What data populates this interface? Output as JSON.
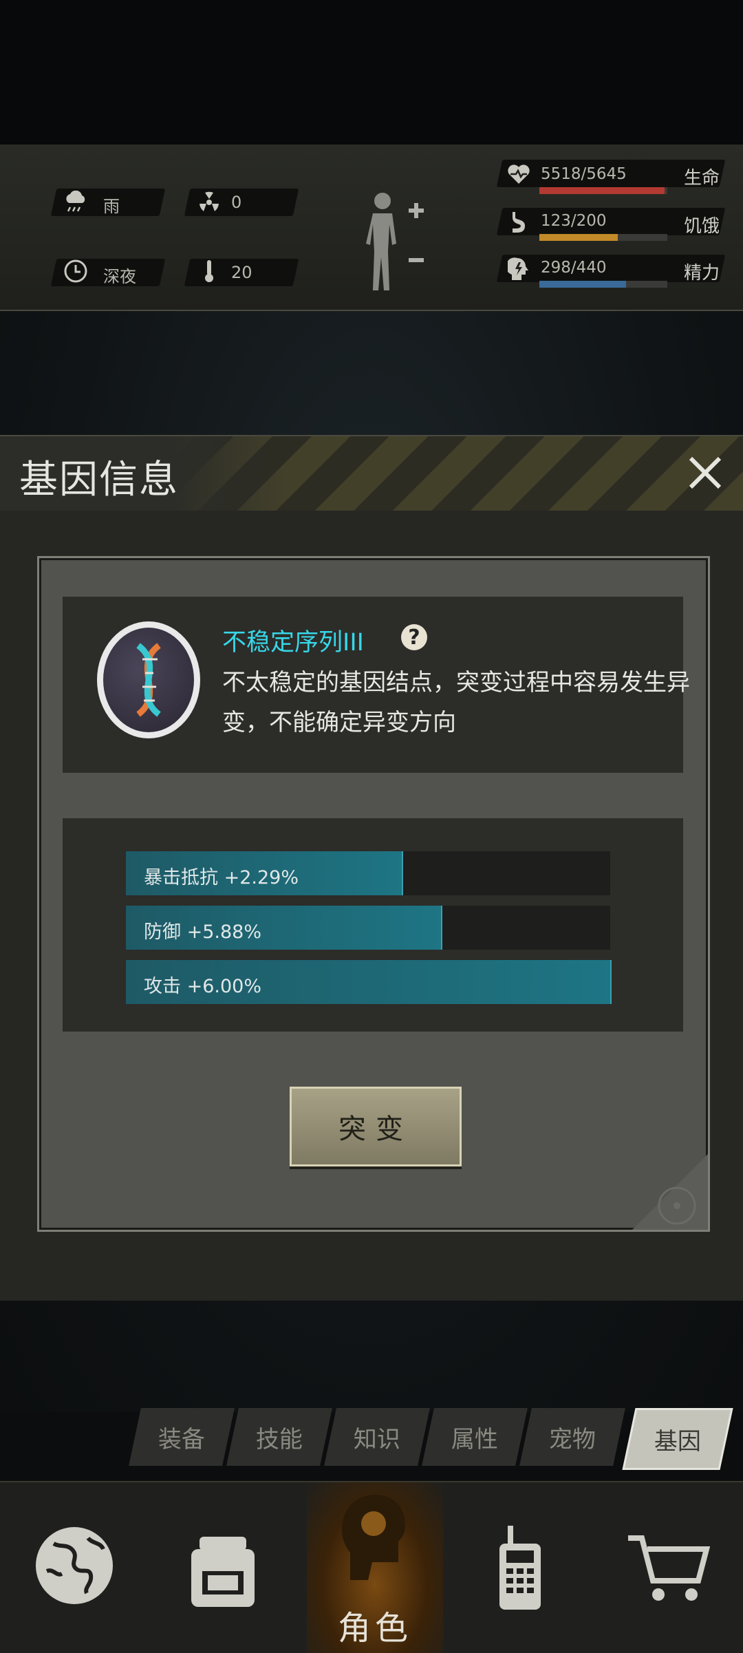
{
  "status": {
    "weather": "雨",
    "radiation": "0",
    "time_of_day": "深夜",
    "temperature": "20",
    "hp": {
      "text": "5518/5645",
      "label": "生命",
      "fraction": 0.977,
      "color": "#b23a32"
    },
    "hunger": {
      "text": "123/200",
      "label": "饥饿",
      "fraction": 0.615,
      "color": "#c28a28"
    },
    "energy": {
      "text": "298/440",
      "label": "精力",
      "fraction": 0.677,
      "color": "#3a6a9a"
    }
  },
  "modal": {
    "title": "基因信息",
    "gene_name": "不稳定序列III",
    "help": "?",
    "description": "不太稳定的基因结点，突变过程中容易发生异变，不能确定异变方向",
    "stats": [
      {
        "label": "暴击抵抗 +2.29%",
        "fraction": 0.57
      },
      {
        "label": "防御 +5.88%",
        "fraction": 0.65
      },
      {
        "label": "攻击 +6.00%",
        "fraction": 1.0
      }
    ],
    "mutate_label": "突变"
  },
  "tabs": [
    "装备",
    "技能",
    "知识",
    "属性",
    "宠物",
    "基因"
  ],
  "active_tab": "基因",
  "nav": {
    "active_label": "角色",
    "items": [
      "world-map-icon",
      "backpack-icon",
      "character-icon",
      "radio-icon",
      "cart-icon"
    ]
  }
}
